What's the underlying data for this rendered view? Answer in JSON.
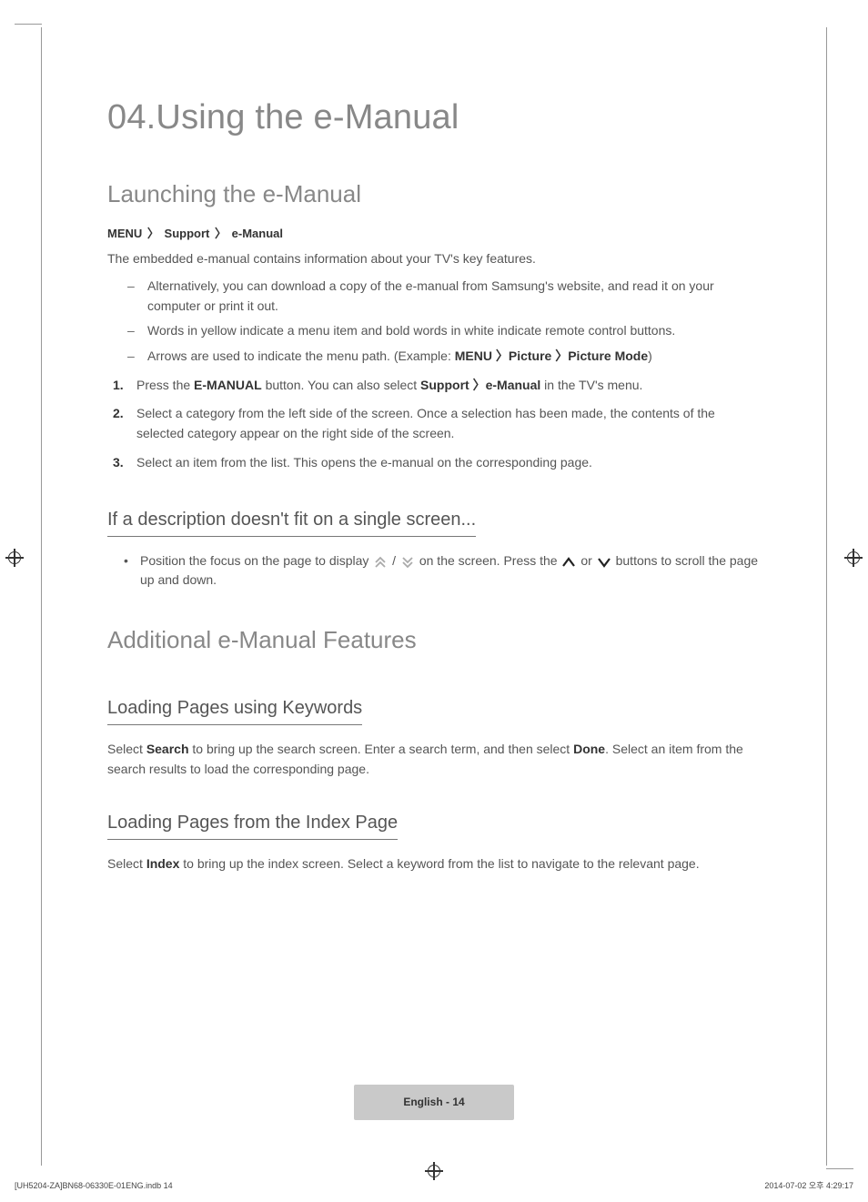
{
  "chapter_title": "04.Using the e-Manual",
  "s1": {
    "title": "Launching the e-Manual",
    "breadcrumb": [
      "MENU",
      "Support",
      "e-Manual"
    ],
    "intro": "The embedded e-manual contains information about your TV's key features.",
    "bullets": [
      "Alternatively, you can download a copy of the e-manual from Samsung's website, and read it on your computer or print it out.",
      "Words in yellow indicate a menu item and bold words in white indicate remote control buttons."
    ],
    "bullet_arrows_pre": "Arrows are used to indicate the menu path. (Example: ",
    "bullet_arrows_path": [
      "MENU",
      "Picture",
      "Picture Mode"
    ],
    "bullet_arrows_post": ")",
    "steps": {
      "step1_a": "Press the ",
      "step1_b": "E-MANUAL",
      "step1_c": " button. You can also select ",
      "step1_d": "Support",
      "step1_e": "e-Manual",
      "step1_f": " in the TV's menu.",
      "step2": "Select a category from the left side of the screen. Once a selection has been made, the contents of the selected category appear on the right side of the screen.",
      "step3": "Select an item from the list. This opens the e-manual on the corresponding page."
    },
    "sub1_title": "If a description doesn't fit on a single screen...",
    "sub1_a": "Position the focus on the page to display ",
    "sub1_b": " / ",
    "sub1_c": " on the screen. Press the ",
    "sub1_or": " or ",
    "sub1_d": " buttons to scroll the page up and down."
  },
  "s2": {
    "title": "Additional e-Manual Features",
    "sub1_title": "Loading Pages using Keywords",
    "sub1_a": "Select ",
    "sub1_b": "Search",
    "sub1_c": " to bring up the search screen. Enter a search term, and then select ",
    "sub1_d": "Done",
    "sub1_e": ". Select an item from the search results to load the corresponding page.",
    "sub2_title": "Loading Pages from the Index Page",
    "sub2_a": "Select ",
    "sub2_b": "Index",
    "sub2_c": " to bring up the index screen. Select a keyword from the list to navigate to the relevant page."
  },
  "footer": "English - 14",
  "meta_left": "[UH5204-ZA]BN68-06330E-01ENG.indb   14",
  "meta_right": "2014-07-02   오후 4:29:17"
}
